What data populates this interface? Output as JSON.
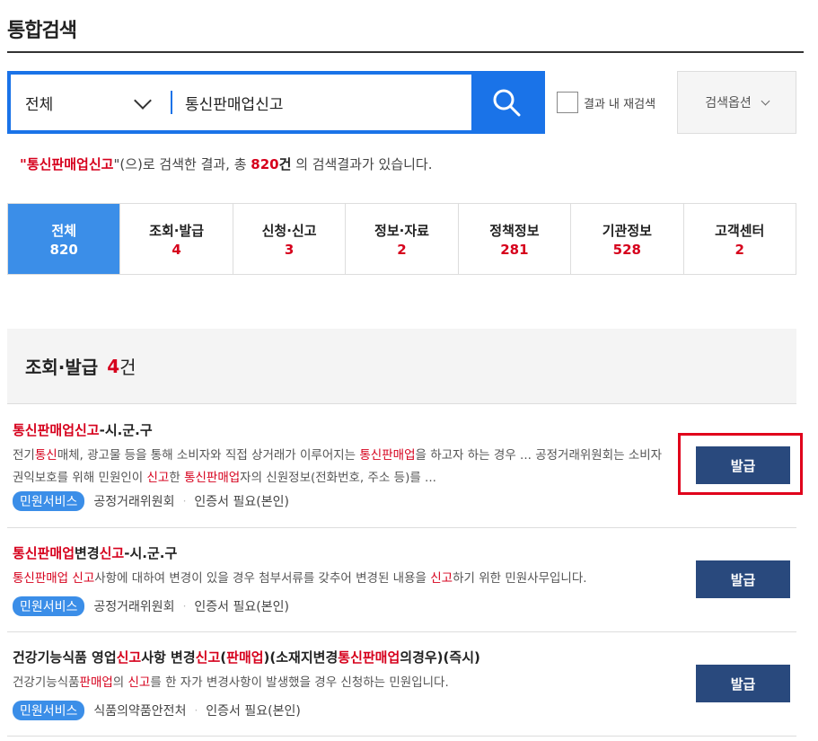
{
  "header": {
    "title": "통합검색"
  },
  "search": {
    "scope": "전체",
    "query": "통신판매업신고",
    "re_search_label": "결과 내 재검색",
    "options_label": "검색옵션"
  },
  "summary": {
    "open_quote": "\"",
    "keyword": "통신판매업신고",
    "mid": "\"(으)로 검색한 결과, 총 ",
    "total": "820",
    "unit": "건",
    "end": " 의 검색결과가 있습니다."
  },
  "tabs": [
    {
      "label": "전체",
      "count": "820"
    },
    {
      "label": "조회·발급",
      "count": "4"
    },
    {
      "label": "신청·신고",
      "count": "3"
    },
    {
      "label": "정보·자료",
      "count": "2"
    },
    {
      "label": "정책정보",
      "count": "281"
    },
    {
      "label": "기관정보",
      "count": "528"
    },
    {
      "label": "고객센터",
      "count": "2"
    }
  ],
  "section": {
    "title": "조회·발급",
    "count": "4",
    "unit": "건"
  },
  "results": [
    {
      "title": [
        "통신판매업신고",
        "-시.군.구"
      ],
      "desc": [
        "전기",
        "통신",
        "매체, 광고물 등을 통해 소비자와 직접 상거래가 이루어지는 ",
        "통신판매업",
        "을 하고자 하는 경우 ... 공정거래위원회는 소비자 권익보호를 위해 민원인이 ",
        "신고",
        "한 ",
        "통신판매업",
        "자의 신원정보(전화번호, 주소 등)를 ..."
      ],
      "tag": "민원서비스",
      "org": "공정거래위원회",
      "cert": "인증서 필요(본인)",
      "button": "발급"
    },
    {
      "title": [
        "통신판매업",
        "변경",
        "신고",
        "-시.군.구"
      ],
      "desc": [
        "통신판매업",
        " ",
        "신고",
        "사항에 대하여 변경이 있을 경우 첨부서류를 갖추어 변경된 내용을 ",
        "신고",
        "하기 위한 민원사무입니다."
      ],
      "tag": "민원서비스",
      "org": "공정거래위원회",
      "cert": "인증서 필요(본인)",
      "button": "발급"
    },
    {
      "title": [
        "건강기능식품 영업",
        "신고",
        "사항 변경",
        "신고",
        "(",
        "판매업",
        ")(소재지변경",
        "통신판매업",
        "의경우)(즉시)"
      ],
      "desc": [
        "건강기능식품",
        "판매업",
        "의 ",
        "신고",
        "를 한 자가 변경사항이 발생했을 경우 신청하는 민원입니다."
      ],
      "tag": "민원서비스",
      "org": "식품의약품안전처",
      "cert": "인증서 필요(본인)",
      "button": "발급"
    }
  ],
  "colors": {
    "accent": "#1a73e8",
    "tab_active": "#3b8ee8",
    "highlight": "#d6001c",
    "button": "#29497d",
    "annotation": "#e0001b"
  },
  "icons": {
    "search_button": "search-icon",
    "scope_select": "chevron-down-icon",
    "options": "chevron-down-icon"
  }
}
